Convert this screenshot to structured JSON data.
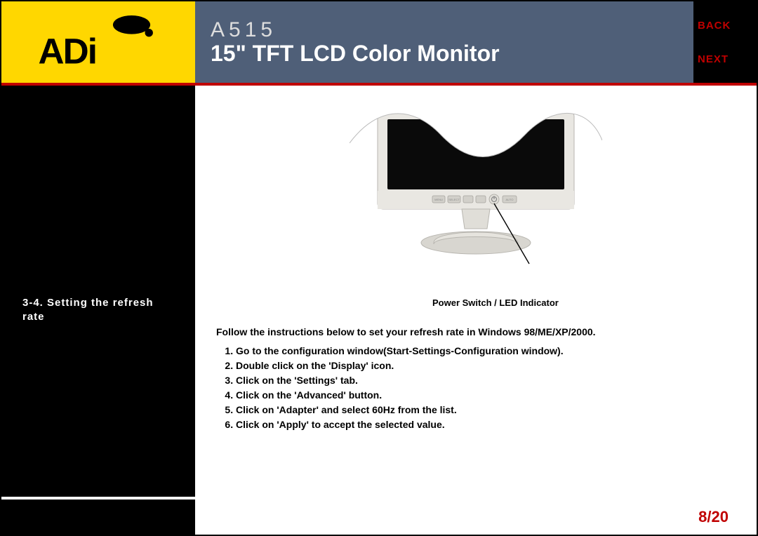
{
  "brand": "ADi",
  "header": {
    "model": "A515",
    "title": "15\" TFT LCD Color Monitor"
  },
  "nav": {
    "back": "BACK",
    "next": "NEXT"
  },
  "sidebar": {
    "section_num": "3-4.",
    "section_title": "Setting the refresh rate"
  },
  "illustration": {
    "callout": "Power Switch / LED Indicator",
    "buttons": [
      "MENU",
      "SELECT",
      "▼",
      "▲",
      "⏻",
      "AUTO"
    ]
  },
  "instructions": {
    "intro": "Follow the instructions below to set your refresh rate in Windows 98/ME/XP/2000.",
    "steps": [
      "Go to the configuration window(Start-Settings-Configuration window).",
      "Double click on the 'Display' icon.",
      "Click on the 'Settings' tab.",
      "Click on the 'Advanced' button.",
      "Click on 'Adapter' and select 60Hz from the list.",
      "Click on 'Apply' to accept the selected value."
    ]
  },
  "page": "8/20"
}
